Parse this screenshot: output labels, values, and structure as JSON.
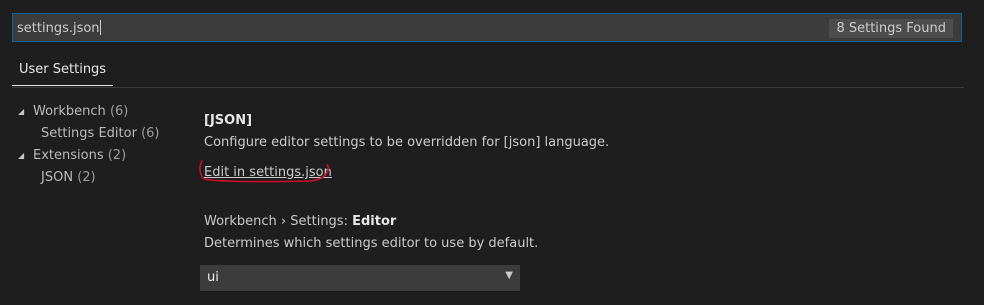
{
  "search": {
    "value": "settings.json",
    "results_badge": "8 Settings Found"
  },
  "tabs": [
    {
      "label": "User Settings",
      "active": true
    }
  ],
  "toc": [
    {
      "label": "Workbench",
      "count": "(6)",
      "level": 1,
      "expanded": true
    },
    {
      "label": "Settings Editor",
      "count": "(6)",
      "level": 2
    },
    {
      "label": "Extensions",
      "count": "(2)",
      "level": 1,
      "expanded": true
    },
    {
      "label": "JSON",
      "count": "(2)",
      "level": 2
    }
  ],
  "settings": {
    "json_language": {
      "title": "[JSON]",
      "description": "Configure editor settings to be overridden for [json] language.",
      "link_label": "Edit in settings.json",
      "annotation_color": "#c8102e"
    },
    "settings_editor": {
      "category": "Workbench › Settings: ",
      "name": "Editor",
      "description": "Determines which settings editor to use by default.",
      "value": "ui"
    }
  },
  "icons": {
    "twistie": "triangle-expanded-icon",
    "dropdown": "chevron-down-icon"
  },
  "colors": {
    "background": "#1e1e1e",
    "input_background": "#3c3c3c",
    "focus_border": "#0e639c",
    "badge_background": "#4d4d4d"
  }
}
